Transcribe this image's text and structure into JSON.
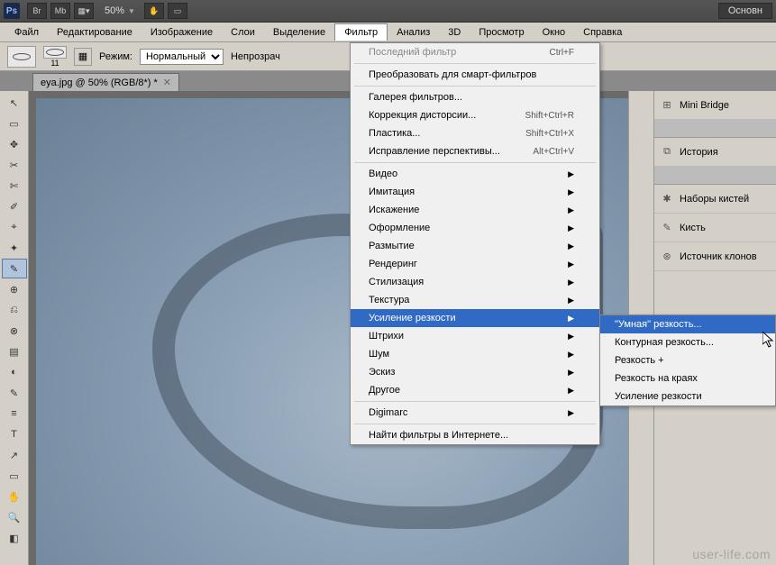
{
  "titlebar": {
    "zoom": "50%",
    "right_button": "Основн"
  },
  "menubar": [
    "Файл",
    "Редактирование",
    "Изображение",
    "Слои",
    "Выделение",
    "Фильтр",
    "Анализ",
    "3D",
    "Просмотр",
    "Окно",
    "Справка"
  ],
  "menubar_active_index": 5,
  "optbar": {
    "brush_size": "11",
    "mode_label": "Режим:",
    "mode_value": "Нормальный",
    "opacity_label": "Непрозрач"
  },
  "tab": {
    "title": "eya.jpg @ 50% (RGB/8*) *"
  },
  "dropdown": {
    "sections": [
      [
        {
          "label": "Последний фильтр",
          "shortcut": "Ctrl+F",
          "disabled": true
        }
      ],
      [
        {
          "label": "Преобразовать для смарт-фильтров"
        }
      ],
      [
        {
          "label": "Галерея фильтров..."
        },
        {
          "label": "Коррекция дисторсии...",
          "shortcut": "Shift+Ctrl+R"
        },
        {
          "label": "Пластика...",
          "shortcut": "Shift+Ctrl+X"
        },
        {
          "label": "Исправление перспективы...",
          "shortcut": "Alt+Ctrl+V"
        }
      ],
      [
        {
          "label": "Видео",
          "submenu": true
        },
        {
          "label": "Имитация",
          "submenu": true
        },
        {
          "label": "Искажение",
          "submenu": true
        },
        {
          "label": "Оформление",
          "submenu": true
        },
        {
          "label": "Размытие",
          "submenu": true
        },
        {
          "label": "Рендеринг",
          "submenu": true
        },
        {
          "label": "Стилизация",
          "submenu": true
        },
        {
          "label": "Текстура",
          "submenu": true
        },
        {
          "label": "Усиление резкости",
          "submenu": true,
          "highlight": true
        },
        {
          "label": "Штрихи",
          "submenu": true
        },
        {
          "label": "Шум",
          "submenu": true
        },
        {
          "label": "Эскиз",
          "submenu": true
        },
        {
          "label": "Другое",
          "submenu": true
        }
      ],
      [
        {
          "label": "Digimarc",
          "submenu": true
        }
      ],
      [
        {
          "label": "Найти фильтры в Интернете..."
        }
      ]
    ]
  },
  "submenu": {
    "items": [
      {
        "label": "\"Умная\" резкость...",
        "highlight": true
      },
      {
        "label": "Контурная резкость..."
      },
      {
        "label": "Резкость +"
      },
      {
        "label": "Резкость на краях"
      },
      {
        "label": "Усиление резкости"
      }
    ]
  },
  "panels": [
    {
      "icon": "⊞",
      "label": "Mini Bridge"
    },
    null,
    {
      "icon": "⧉",
      "label": "История"
    },
    null,
    {
      "icon": "✱",
      "label": "Наборы кистей"
    },
    {
      "icon": "✎",
      "label": "Кисть"
    },
    {
      "icon": "⊛",
      "label": "Источник клонов"
    }
  ],
  "watermark": "user-life.com"
}
